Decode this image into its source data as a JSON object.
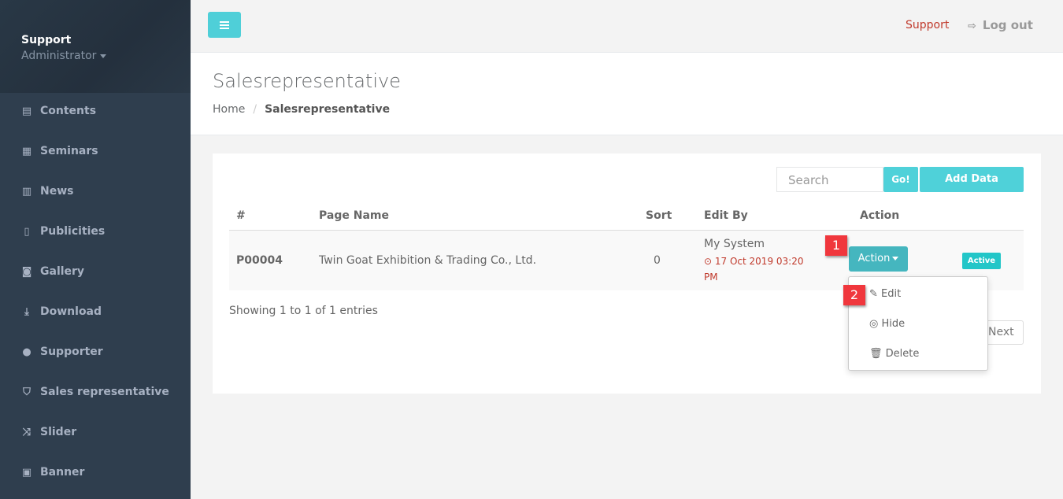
{
  "sidebar": {
    "user": "Support",
    "role": "Administrator",
    "items": [
      {
        "label": "Contents",
        "icon": "list-alt-icon",
        "glyph": "▤"
      },
      {
        "label": "Seminars",
        "icon": "calendar-icon",
        "glyph": "▦"
      },
      {
        "label": "News",
        "icon": "newspaper-icon",
        "glyph": "▥"
      },
      {
        "label": "Publicities",
        "icon": "building-icon",
        "glyph": "▯"
      },
      {
        "label": "Gallery",
        "icon": "camera-icon",
        "glyph": "◙"
      },
      {
        "label": "Download",
        "icon": "download-icon",
        "glyph": "⤓"
      },
      {
        "label": "Supporter",
        "icon": "users-icon",
        "glyph": "●"
      },
      {
        "label": "Sales representative",
        "icon": "bookmark-icon",
        "glyph": "⛉"
      },
      {
        "label": "Slider",
        "icon": "random-icon",
        "glyph": "⤨"
      },
      {
        "label": "Banner",
        "icon": "image-icon",
        "glyph": "▣"
      }
    ]
  },
  "topbar": {
    "support": "Support",
    "logout": "Log out"
  },
  "page": {
    "title": "Salesrepresentative",
    "breadcrumb": [
      "Home",
      "Salesrepresentative"
    ]
  },
  "toolbar": {
    "search_placeholder": "Search",
    "go": "Go!",
    "add": "Add Data"
  },
  "table": {
    "headers": [
      "#",
      "Page Name",
      "Sort",
      "Edit By",
      "Action"
    ],
    "rows": [
      {
        "id": "P00004",
        "name": "Twin Goat Exhibition & Trading Co., Ltd.",
        "sort": "0",
        "edit_by": "My System",
        "date": "17 Oct 2019 03:20",
        "date2": "PM",
        "action": "Action",
        "status": "Active"
      }
    ]
  },
  "footer": {
    "showing": "Showing 1 to 1 of 1 entries",
    "next": "Next"
  },
  "dropdown": {
    "edit": "Edit",
    "hide": "Hide",
    "delete": "Delete"
  },
  "markers": [
    "1",
    "2"
  ]
}
